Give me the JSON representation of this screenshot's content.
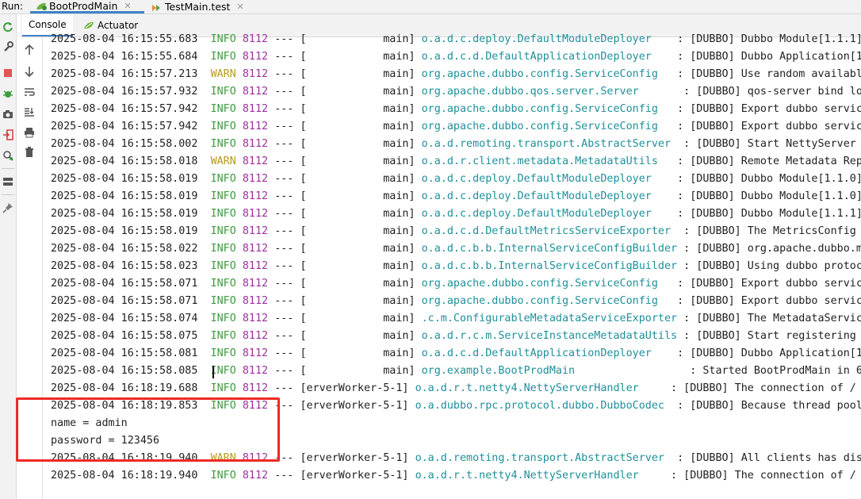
{
  "run_bar": {
    "label": "Run:",
    "tabs": [
      {
        "label": "BootProdMain",
        "icon": "spring-boot-icon",
        "active": true
      },
      {
        "label": "TestMain.test",
        "icon": "test-run-icon",
        "active": false
      }
    ]
  },
  "sub_tabs": [
    {
      "label": "Console",
      "active": true
    },
    {
      "label": "Actuator",
      "icon": "actuator-icon",
      "active": false
    }
  ],
  "left_toolbar": [
    "rerun-icon",
    "wrench-icon",
    "stop-icon",
    "debug-icon",
    "camera-icon",
    "login-icon",
    "settings-search-icon",
    "layout-icon",
    "pin-icon"
  ],
  "console_toolbar": [
    "up-arrow-icon",
    "down-arrow-icon",
    "soft-wrap-icon",
    "scroll-to-end-icon",
    "print-icon",
    "trash-icon"
  ],
  "colors": {
    "info": "#3f9d3f",
    "warn": "#b79a1a",
    "pid": "#a0309e",
    "logger": "#1f8f9a",
    "highlight": "#ee2a24",
    "active_tab": "#4083c9"
  },
  "log_lines": [
    {
      "ts": "2025-08-04 16:15:55.683",
      "level": "INFO",
      "pid": "8112",
      "sep": "---",
      "thread": "[            main]",
      "logger": "o.a.d.c.deploy.DefaultModuleDeployer   ",
      "colon": ":",
      "msg": "[DUBBO] Dubbo Module[1.1.1]"
    },
    {
      "ts": "2025-08-04 16:15:55.684",
      "level": "INFO",
      "pid": "8112",
      "sep": "---",
      "thread": "[            main]",
      "logger": "o.a.d.c.d.DefaultApplicationDeployer   ",
      "colon": ":",
      "msg": "[DUBBO] Dubbo Application[1"
    },
    {
      "ts": "2025-08-04 16:15:57.213",
      "level": "WARN",
      "pid": "8112",
      "sep": "---",
      "thread": "[            main]",
      "logger": "org.apache.dubbo.config.ServiceConfig  ",
      "colon": ":",
      "msg": "[DUBBO] Use random availabl"
    },
    {
      "ts": "2025-08-04 16:15:57.932",
      "level": "INFO",
      "pid": "8112",
      "sep": "---",
      "thread": "[            main]",
      "logger": "org.apache.dubbo.qos.server.Server      ",
      "colon": ":",
      "msg": "[DUBBO] qos-server bind loc"
    },
    {
      "ts": "2025-08-04 16:15:57.942",
      "level": "INFO",
      "pid": "8112",
      "sep": "---",
      "thread": "[            main]",
      "logger": "org.apache.dubbo.config.ServiceConfig  ",
      "colon": ":",
      "msg": "[DUBBO] Export dubbo servic"
    },
    {
      "ts": "2025-08-04 16:15:57.942",
      "level": "INFO",
      "pid": "8112",
      "sep": "---",
      "thread": "[            main]",
      "logger": "org.apache.dubbo.config.ServiceConfig  ",
      "colon": ":",
      "msg": "[DUBBO] Export dubbo servic"
    },
    {
      "ts": "2025-08-04 16:15:58.002",
      "level": "INFO",
      "pid": "8112",
      "sep": "---",
      "thread": "[            main]",
      "logger": "o.a.d.remoting.transport.AbstractServer ",
      "colon": ":",
      "msg": "[DUBBO] Start NettyServer b"
    },
    {
      "ts": "2025-08-04 16:15:58.018",
      "level": "WARN",
      "pid": "8112",
      "sep": "---",
      "thread": "[            main]",
      "logger": "o.a.d.r.client.metadata.MetadataUtils  ",
      "colon": ":",
      "msg": "[DUBBO] Remote Metadata Rep"
    },
    {
      "ts": "2025-08-04 16:15:58.019",
      "level": "INFO",
      "pid": "8112",
      "sep": "---",
      "thread": "[            main]",
      "logger": "o.a.d.c.deploy.DefaultModuleDeployer   ",
      "colon": ":",
      "msg": "[DUBBO] Dubbo Module[1.1.0]"
    },
    {
      "ts": "2025-08-04 16:15:58.019",
      "level": "INFO",
      "pid": "8112",
      "sep": "---",
      "thread": "[            main]",
      "logger": "o.a.d.c.deploy.DefaultModuleDeployer   ",
      "colon": ":",
      "msg": "[DUBBO] Dubbo Module[1.1.0]"
    },
    {
      "ts": "2025-08-04 16:15:58.019",
      "level": "INFO",
      "pid": "8112",
      "sep": "---",
      "thread": "[            main]",
      "logger": "o.a.d.c.deploy.DefaultModuleDeployer   ",
      "colon": ":",
      "msg": "[DUBBO] Dubbo Module[1.1.1]"
    },
    {
      "ts": "2025-08-04 16:15:58.019",
      "level": "INFO",
      "pid": "8112",
      "sep": "---",
      "thread": "[            main]",
      "logger": "o.a.d.c.d.DefaultMetricsServiceExporter ",
      "colon": ":",
      "msg": "[DUBBO] The MetricsConfig n"
    },
    {
      "ts": "2025-08-04 16:15:58.022",
      "level": "INFO",
      "pid": "8112",
      "sep": "---",
      "thread": "[            main]",
      "logger": "o.a.d.c.b.b.InternalServiceConfigBuilder",
      "colon": ":",
      "msg": "[DUBBO] org.apache.dubbo.me"
    },
    {
      "ts": "2025-08-04 16:15:58.023",
      "level": "INFO",
      "pid": "8112",
      "sep": "---",
      "thread": "[            main]",
      "logger": "o.a.d.c.b.b.InternalServiceConfigBuilder",
      "colon": ":",
      "msg": "[DUBBO] Using dubbo protoco"
    },
    {
      "ts": "2025-08-04 16:15:58.071",
      "level": "INFO",
      "pid": "8112",
      "sep": "---",
      "thread": "[            main]",
      "logger": "org.apache.dubbo.config.ServiceConfig  ",
      "colon": ":",
      "msg": "[DUBBO] Export dubbo servic"
    },
    {
      "ts": "2025-08-04 16:15:58.071",
      "level": "INFO",
      "pid": "8112",
      "sep": "---",
      "thread": "[            main]",
      "logger": "org.apache.dubbo.config.ServiceConfig  ",
      "colon": ":",
      "msg": "[DUBBO] Export dubbo servic"
    },
    {
      "ts": "2025-08-04 16:15:58.074",
      "level": "INFO",
      "pid": "8112",
      "sep": "---",
      "thread": "[            main]",
      "logger": ".c.m.ConfigurableMetadataServiceExporter",
      "colon": ":",
      "msg": "[DUBBO] The MetadataService"
    },
    {
      "ts": "2025-08-04 16:15:58.075",
      "level": "INFO",
      "pid": "8112",
      "sep": "---",
      "thread": "[            main]",
      "logger": "o.a.d.r.c.m.ServiceInstanceMetadataUtils",
      "colon": ":",
      "msg": "[DUBBO] Start registering i"
    },
    {
      "ts": "2025-08-04 16:15:58.081",
      "level": "INFO",
      "pid": "8112",
      "sep": "---",
      "thread": "[            main]",
      "logger": "o.a.d.c.d.DefaultApplicationDeployer   ",
      "colon": ":",
      "msg": "[DUBBO] Dubbo Application[1"
    },
    {
      "ts": "2025-08-04 16:15:58.085",
      "level": "INFO",
      "pid": "8112",
      "sep": "---",
      "thread": "[            main]",
      "logger": "org.example.BootProdMain               ",
      "colon": " ",
      "msg": ": Started BootProdMain in 6.35"
    },
    {
      "ts": "2025-08-04 16:18:19.688",
      "level": "INFO",
      "pid": "8112",
      "sep": "---",
      "thread": "[erverWorker-5-1]",
      "logger": "o.a.d.r.t.netty4.NettyServerHandler    ",
      "colon": ":",
      "msg": "[DUBBO] The connection of /"
    },
    {
      "ts": "2025-08-04 16:18:19.853",
      "level": "INFO",
      "pid": "8112",
      "sep": "---",
      "thread": "[erverWorker-5-1]",
      "logger": "o.a.dubbo.rpc.protocol.dubbo.DubboCodec ",
      "colon": ":",
      "msg": "[DUBBO] Because thread pool"
    },
    {
      "plain": "name = admin"
    },
    {
      "plain": "password = 123456"
    },
    {
      "ts": "2025-08-04 16:18:19.940",
      "level": "WARN",
      "pid": "8112",
      "sep": "---",
      "thread": "[erverWorker-5-1]",
      "logger": "o.a.d.remoting.transport.AbstractServer ",
      "colon": ":",
      "msg": "[DUBBO] All clients has dis"
    },
    {
      "ts": "2025-08-04 16:18:19.940",
      "level": "INFO",
      "pid": "8112",
      "sep": "---",
      "thread": "[erverWorker-5-1]",
      "logger": "o.a.d.r.t.netty4.NettyServerHandler    ",
      "colon": ":",
      "msg": "[DUBBO] The connection of /"
    }
  ]
}
